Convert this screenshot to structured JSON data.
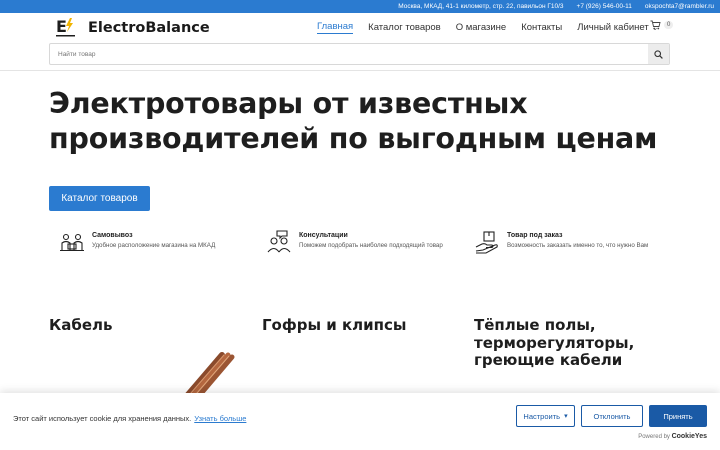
{
  "topbar": {
    "address": "Москва, МКАД, 41-1 километр, стр. 22, павильон Г10/3",
    "phone": "+7 (926) 546-00-11",
    "email": "okspochta7@rambler.ru"
  },
  "header": {
    "brand": "ElectroBalance",
    "logo_letter": "E",
    "nav": [
      {
        "label": "Главная",
        "active": true
      },
      {
        "label": "Каталог товаров"
      },
      {
        "label": "О магазине"
      },
      {
        "label": "Контакты"
      },
      {
        "label": "Личный кабинет"
      }
    ],
    "cart_count": "0",
    "search_placeholder": "Найти товар"
  },
  "hero": {
    "title": "Электротовары от известных производителей по выгодным ценам",
    "button": "Каталог товаров"
  },
  "features": [
    {
      "icon": "pickup-icon",
      "title": "Самовывоз",
      "desc": "Удобное расположение магазина на МКАД"
    },
    {
      "icon": "consult-icon",
      "title": "Консультации",
      "desc": "Поможем подобрать наиболее подходящий товар"
    },
    {
      "icon": "order-icon",
      "title": "Товар под заказ",
      "desc": "Возможность заказать именно то, что нужно Вам"
    }
  ],
  "categories": [
    {
      "title": "Кабель"
    },
    {
      "title": "Гофры и клипсы"
    },
    {
      "title": "Тёплые полы, терморегуляторы, греющие кабели"
    }
  ],
  "cookie": {
    "text": "Этот сайт использует cookie для хранения данных.",
    "link": "Узнать больше",
    "settings": "Настроить",
    "reject": "Отклонить",
    "accept": "Принять",
    "powered_by": "Powered by",
    "powered_brand": "CookieYes"
  },
  "colors": {
    "accent": "#2b7bd0",
    "cookie_primary": "#1a5aa6"
  }
}
